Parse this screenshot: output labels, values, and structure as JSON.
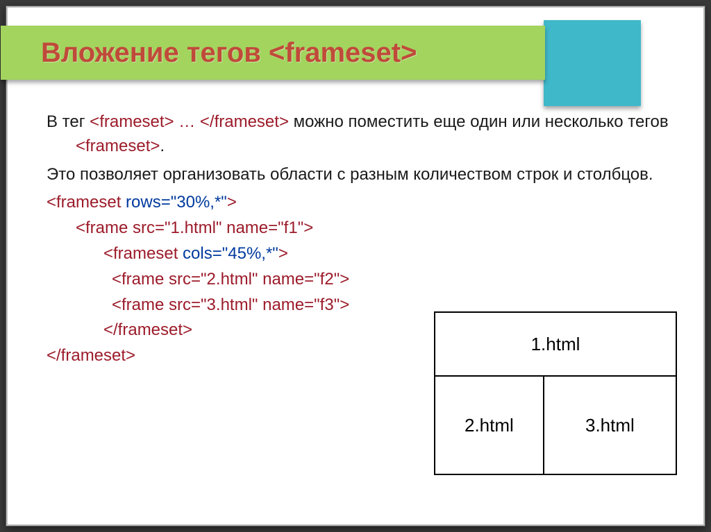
{
  "title": "Вложение тегов <frameset>",
  "para1_a": "В тег ",
  "para1_tag1": "<frameset> … </frameset>",
  "para1_b": " можно поместить еще один или несколько тегов ",
  "para1_tag2": "<frameset>",
  "para1_c": ".",
  "para2": "Это позволяет организовать области с разным количеством строк и столбцов.",
  "code": {
    "l1_a": "<frameset ",
    "l1_b": "rows=\"30%,*\"",
    "l1_c": ">",
    "l2": "<frame src=\"1.html\" name=\"f1\">",
    "l3_a": "<frameset ",
    "l3_b": "cols=\"45%,*\"",
    "l3_c": ">",
    "l4": "<frame src=\"2.html\" name=\"f2\">",
    "l5": "<frame src=\"3.html\" name=\"f3\">",
    "l6": "</frameset>",
    "l7": "</frameset>"
  },
  "diagram": {
    "top": "1.html",
    "left": "2.html",
    "right": "3.html"
  }
}
